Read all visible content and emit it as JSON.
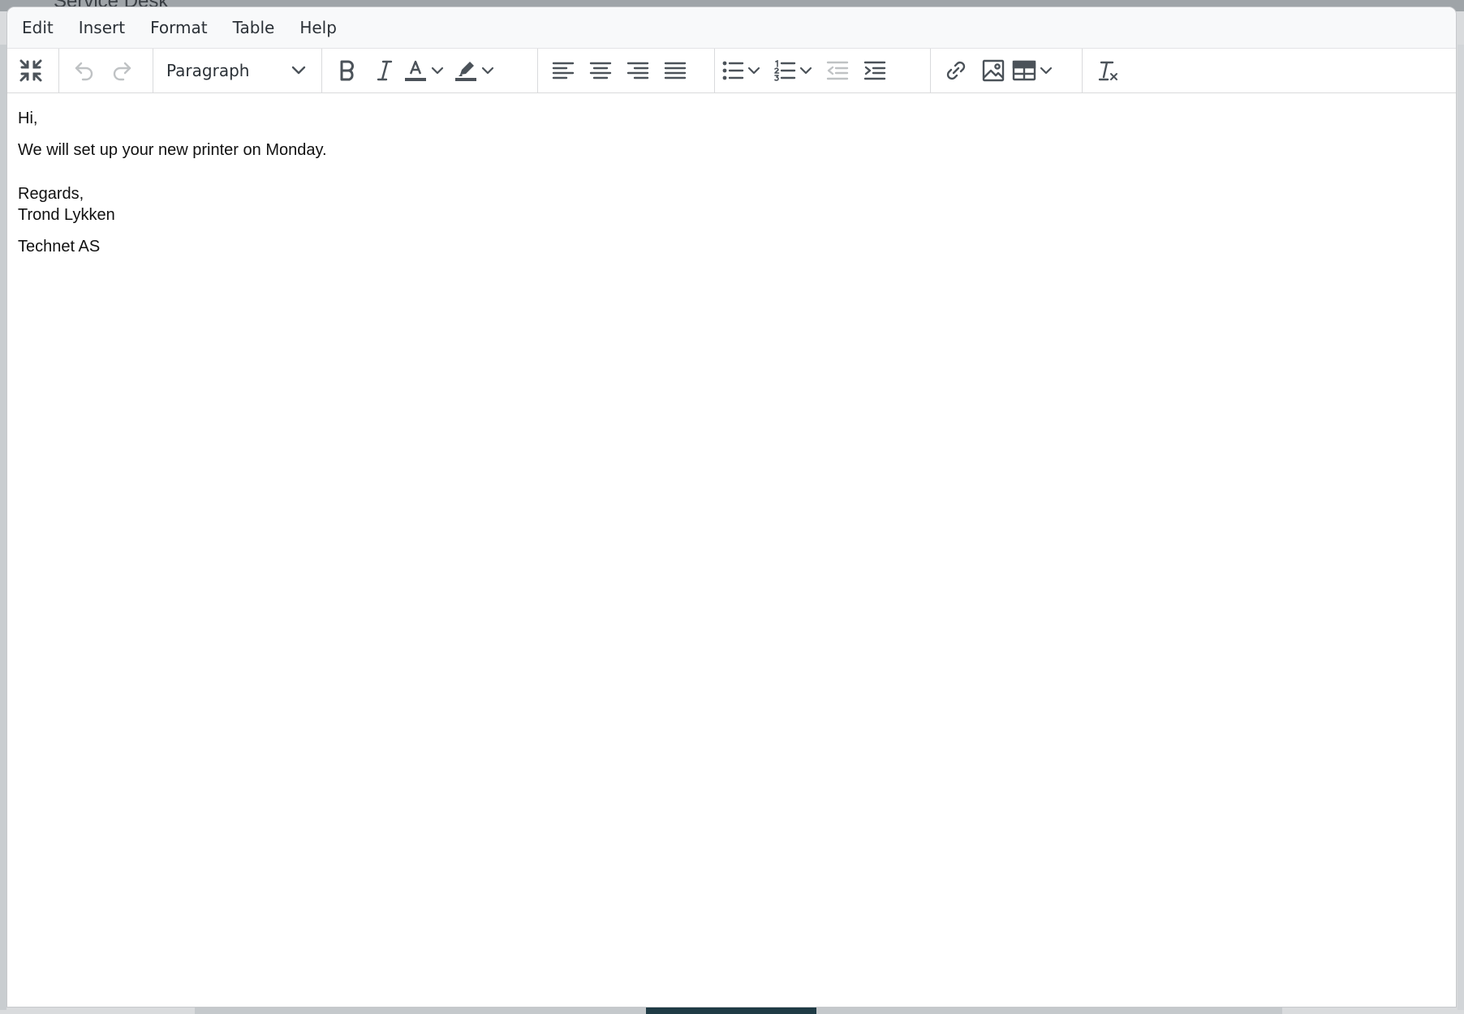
{
  "background": {
    "app_title": "Service Desk"
  },
  "menubar": {
    "items": [
      "Edit",
      "Insert",
      "Format",
      "Table",
      "Help"
    ]
  },
  "toolbar": {
    "block_format": "Paragraph",
    "buttons": [
      "fullscreen-exit",
      "undo",
      "redo",
      "bold",
      "italic",
      "text-color",
      "highlight-color",
      "align-left",
      "align-center",
      "align-right",
      "justify",
      "bullet-list",
      "numbered-list",
      "outdent",
      "indent",
      "link",
      "image",
      "table",
      "clear-formatting"
    ]
  },
  "content": {
    "greeting": "Hi,",
    "body": "We will set up your new printer on Monday.",
    "closing": "Regards,",
    "name": "Trond Lykken",
    "company": "Technet AS"
  },
  "colors": {
    "icon": "#4b5259",
    "disabled_icon": "#b8bcc0",
    "border": "#d9dadc"
  }
}
